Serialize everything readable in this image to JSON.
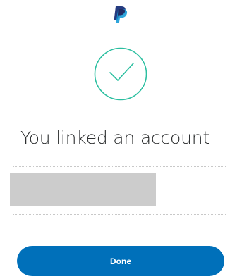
{
  "header": {
    "logo_icon": "paypal-logo-icon",
    "logo_colors": {
      "dark": "#253b80",
      "light": "#179bd7"
    }
  },
  "confirmation": {
    "icon": "checkmark-circle-icon",
    "accent_color": "#2bbfa0",
    "title": "You linked an account"
  },
  "account": {
    "details_redacted": true
  },
  "actions": {
    "done_label": "Done",
    "button_color": "#0070ba"
  }
}
